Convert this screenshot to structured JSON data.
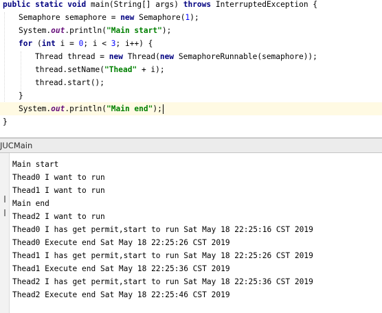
{
  "editor": {
    "lines": [
      [
        {
          "t": "public static void ",
          "c": "kw"
        },
        {
          "t": "main(String[] args) ",
          "c": "plain"
        },
        {
          "t": "throws ",
          "c": "kw"
        },
        {
          "t": "InterruptedException {",
          "c": "plain"
        }
      ],
      [
        {
          "t": "Semaphore semaphore = ",
          "c": "plain"
        },
        {
          "t": "new ",
          "c": "kw"
        },
        {
          "t": "Semaphore(",
          "c": "plain"
        },
        {
          "t": "1",
          "c": "num"
        },
        {
          "t": ");",
          "c": "plain"
        }
      ],
      [
        {
          "t": "System.",
          "c": "plain"
        },
        {
          "t": "out",
          "c": "fld"
        },
        {
          "t": ".println(",
          "c": "plain"
        },
        {
          "t": "\"Main start\"",
          "c": "str"
        },
        {
          "t": ");",
          "c": "plain"
        }
      ],
      [
        {
          "t": "for ",
          "c": "kw"
        },
        {
          "t": "(",
          "c": "plain"
        },
        {
          "t": "int ",
          "c": "kw"
        },
        {
          "t": "i = ",
          "c": "plain"
        },
        {
          "t": "0",
          "c": "num"
        },
        {
          "t": "; i < ",
          "c": "plain"
        },
        {
          "t": "3",
          "c": "num"
        },
        {
          "t": "; i++) {",
          "c": "plain"
        }
      ],
      [
        {
          "t": "Thread thread = ",
          "c": "plain"
        },
        {
          "t": "new ",
          "c": "kw"
        },
        {
          "t": "Thread(",
          "c": "plain"
        },
        {
          "t": "new ",
          "c": "kw"
        },
        {
          "t": "SemaphoreRunnable(semaphore));",
          "c": "plain"
        }
      ],
      [
        {
          "t": "thread.setName(",
          "c": "plain"
        },
        {
          "t": "\"Thead\"",
          "c": "str"
        },
        {
          "t": " + i);",
          "c": "plain"
        }
      ],
      [
        {
          "t": "thread.start();",
          "c": "plain"
        }
      ],
      [
        {
          "t": "}",
          "c": "plain"
        }
      ],
      [
        {
          "t": "System.",
          "c": "plain"
        },
        {
          "t": "out",
          "c": "fld"
        },
        {
          "t": ".println(",
          "c": "plain"
        },
        {
          "t": "\"Main end\"",
          "c": "str"
        },
        {
          "t": ");",
          "c": "plain"
        }
      ],
      [
        {
          "t": "}",
          "c": "plain"
        }
      ]
    ]
  },
  "run_panel": {
    "title": "JUCMain",
    "console_lines": [
      "Main start",
      "Thead0 I want to run",
      "Thead1 I want to run",
      "Main end",
      "Thead2 I want to run",
      "Thead0 I has get permit,start to run Sat May 18 22:25:16 CST 2019",
      "Thead0 Execute end Sat May 18 22:25:26 CST 2019",
      "Thead1 I has get permit,start to run Sat May 18 22:25:26 CST 2019",
      "Thead1 Execute end Sat May 18 22:25:36 CST 2019",
      "Thead2 I has get permit,start to run Sat May 18 22:25:36 CST 2019",
      "Thead2 Execute end Sat May 18 22:25:46 CST 2019"
    ]
  }
}
